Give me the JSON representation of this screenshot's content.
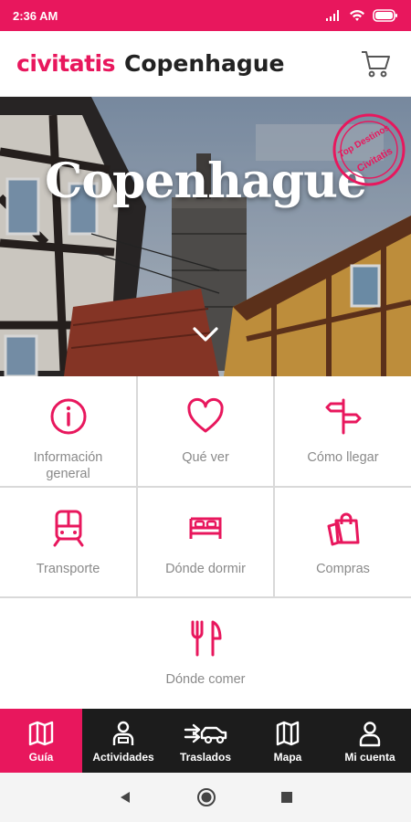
{
  "status": {
    "time": "2:36 AM"
  },
  "header": {
    "brand": "civitatis",
    "city": "Copenhague"
  },
  "hero": {
    "title": "Copenhague",
    "stamp_top": "Top Destinos",
    "stamp_bottom": "Civitatis"
  },
  "menu": [
    {
      "label": "Información general",
      "icon": "info-icon"
    },
    {
      "label": "Qué ver",
      "icon": "heart-icon"
    },
    {
      "label": "Cómo llegar",
      "icon": "signpost-icon"
    },
    {
      "label": "Transporte",
      "icon": "train-icon"
    },
    {
      "label": "Dónde dormir",
      "icon": "bed-icon"
    },
    {
      "label": "Compras",
      "icon": "shopping-bags-icon"
    },
    {
      "label": "Dónde comer",
      "icon": "cutlery-icon"
    }
  ],
  "tabs": [
    {
      "label": "Guía",
      "icon": "map-book-icon",
      "active": true
    },
    {
      "label": "Actividades",
      "icon": "guide-person-icon",
      "active": false
    },
    {
      "label": "Traslados",
      "icon": "transfer-car-icon",
      "active": false
    },
    {
      "label": "Mapa",
      "icon": "map-icon",
      "active": false
    },
    {
      "label": "Mi cuenta",
      "icon": "user-icon",
      "active": false
    }
  ],
  "colors": {
    "brand": "#e8175d",
    "tabbar": "#1c1c1c",
    "tile_text": "#8a8a8a"
  }
}
